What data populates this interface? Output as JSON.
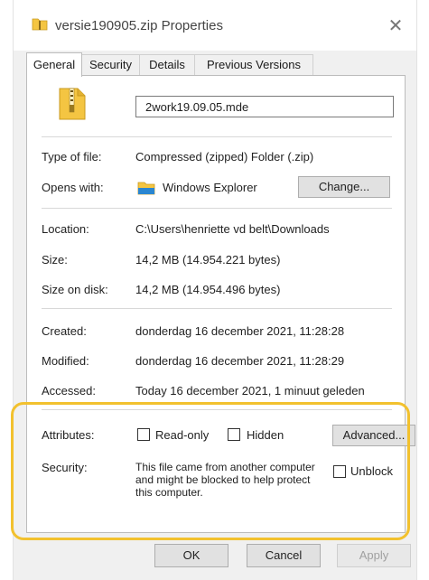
{
  "window": {
    "title": "versie190905.zip Properties",
    "close_glyph": "✕"
  },
  "tabs": [
    {
      "label": "General",
      "active": true
    },
    {
      "label": "Security",
      "active": false
    },
    {
      "label": "Details",
      "active": false
    },
    {
      "label": "Previous Versions",
      "active": false
    }
  ],
  "general": {
    "file_name": "2work19.09.05.mde",
    "type_label": "Type of file:",
    "type_value": "Compressed (zipped) Folder (.zip)",
    "opens_label": "Opens with:",
    "opens_value": "Windows Explorer",
    "change_button": "Change...",
    "location_label": "Location:",
    "location_value": "C:\\Users\\henriette vd belt\\Downloads",
    "size_label": "Size:",
    "size_value": "14,2 MB (14.954.221 bytes)",
    "size_on_disk_label": "Size on disk:",
    "size_on_disk_value": "14,2 MB (14.954.496 bytes)",
    "created_label": "Created:",
    "created_value": "donderdag 16 december 2021, 11:28:28",
    "modified_label": "Modified:",
    "modified_value": "donderdag 16 december 2021, 11:28:29",
    "accessed_label": "Accessed:",
    "accessed_value": "Today 16 december 2021, 1 minuut geleden",
    "attributes_label": "Attributes:",
    "readonly_label": "Read-only",
    "readonly_checked": false,
    "hidden_label": "Hidden",
    "hidden_checked": false,
    "advanced_button": "Advanced...",
    "security_label": "Security:",
    "security_text": "This file came from another computer and might be blocked to help protect this computer.",
    "unblock_label": "Unblock",
    "unblock_checked": false
  },
  "buttons": {
    "ok": "OK",
    "cancel": "Cancel",
    "apply": "Apply",
    "apply_enabled": false
  },
  "colors": {
    "highlight": "#f2c12e",
    "folder_yellow": "#f4c542",
    "explorer_blue": "#2a86d1"
  },
  "icons": {
    "title": "zip-folder-icon",
    "file": "zip-folder-icon",
    "opens_with": "file-explorer-icon"
  }
}
